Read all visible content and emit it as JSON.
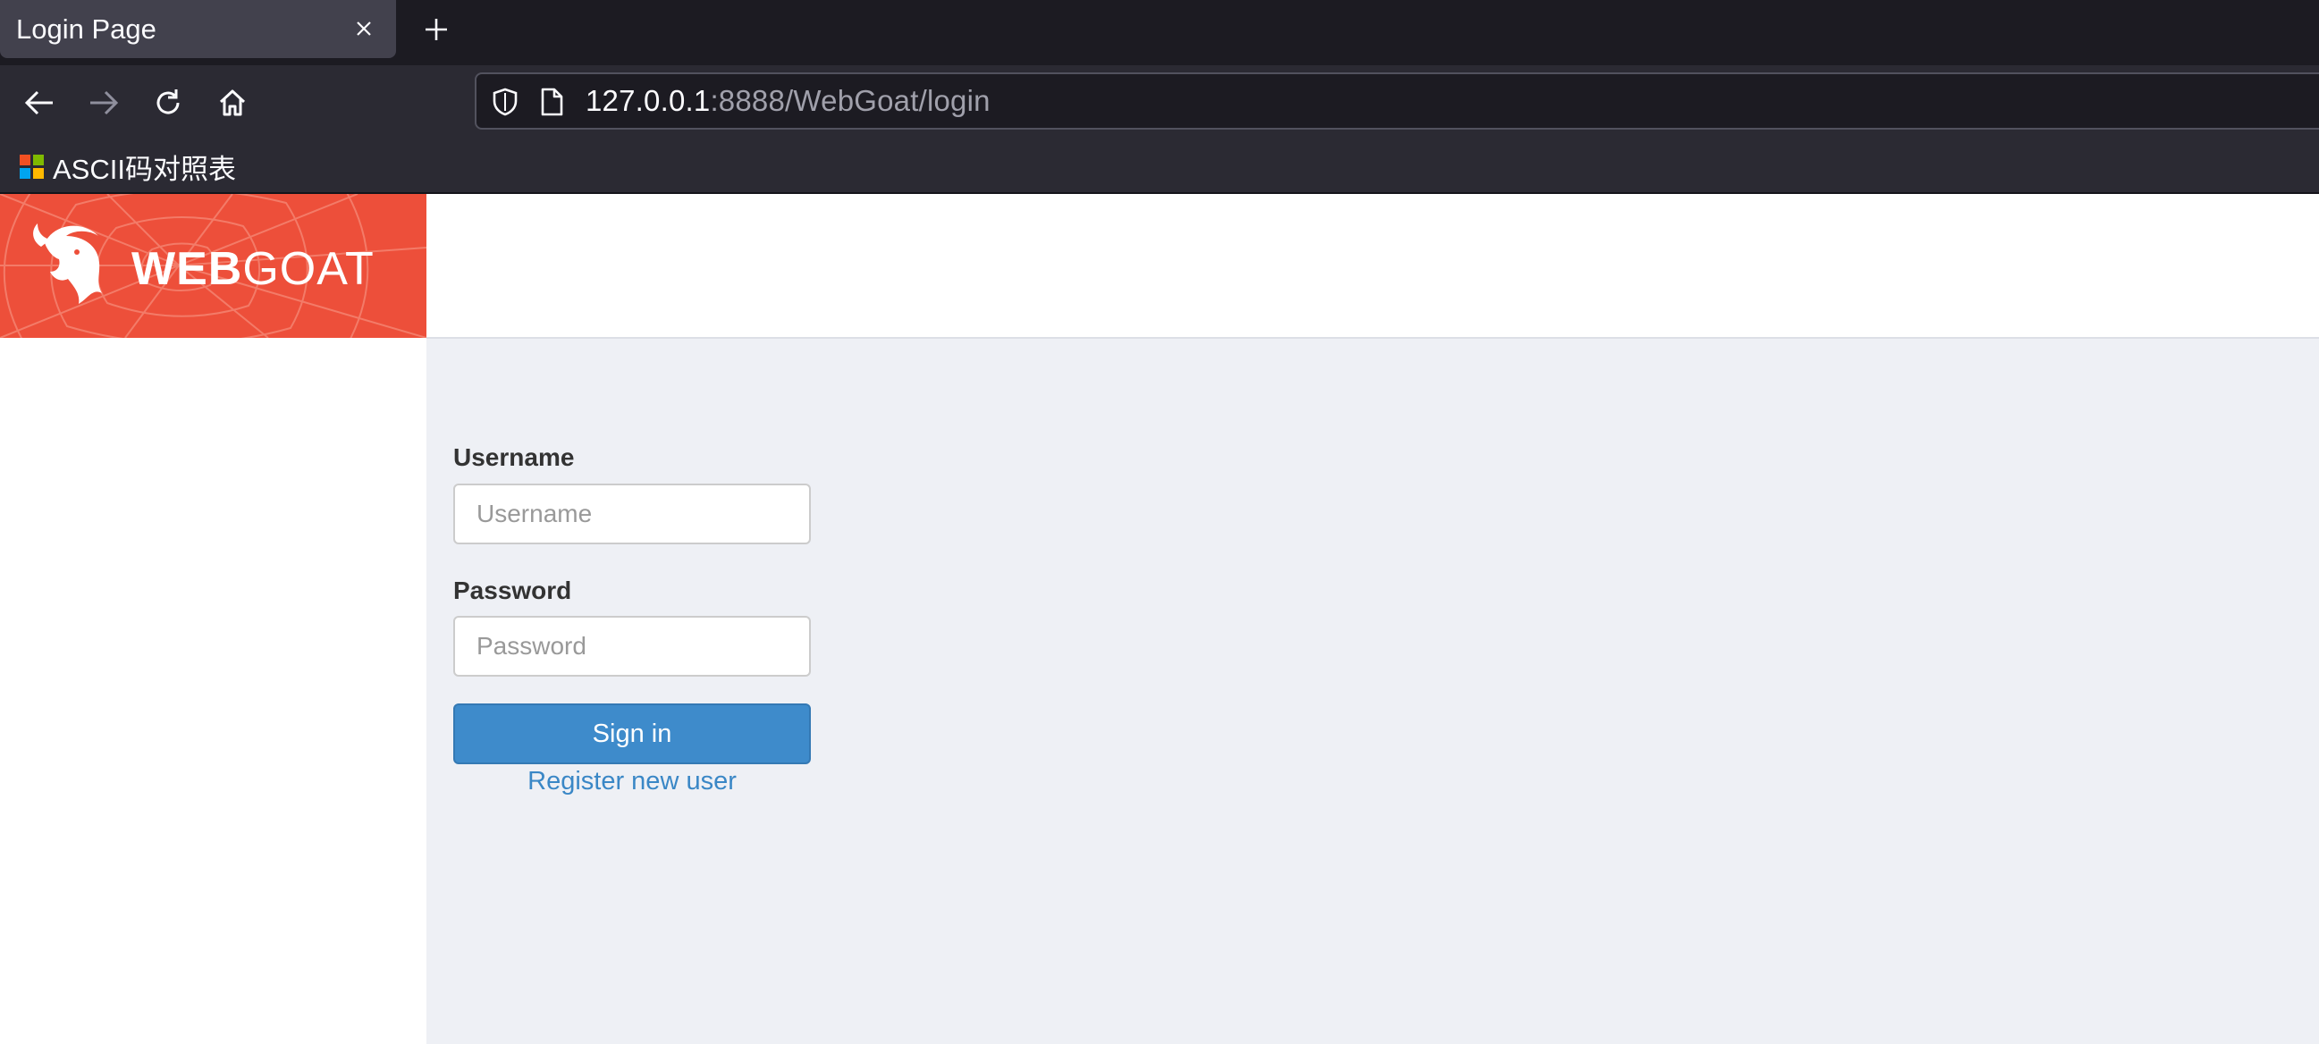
{
  "browser": {
    "tab_title": "Login Page",
    "url_host": "127.0.0.1",
    "url_rest": ":8888/WebGoat/login",
    "bookmark_label": "ASCII码对照表"
  },
  "brand": {
    "web": "WEB",
    "goat": "GOAT",
    "color": "#ed4f3a"
  },
  "login": {
    "username_label": "Username",
    "username_placeholder": "Username",
    "username_value": "",
    "password_label": "Password",
    "password_placeholder": "Password",
    "password_value": "",
    "signin_label": "Sign in",
    "register_label": "Register new user",
    "accent_color": "#3e8bcb"
  }
}
